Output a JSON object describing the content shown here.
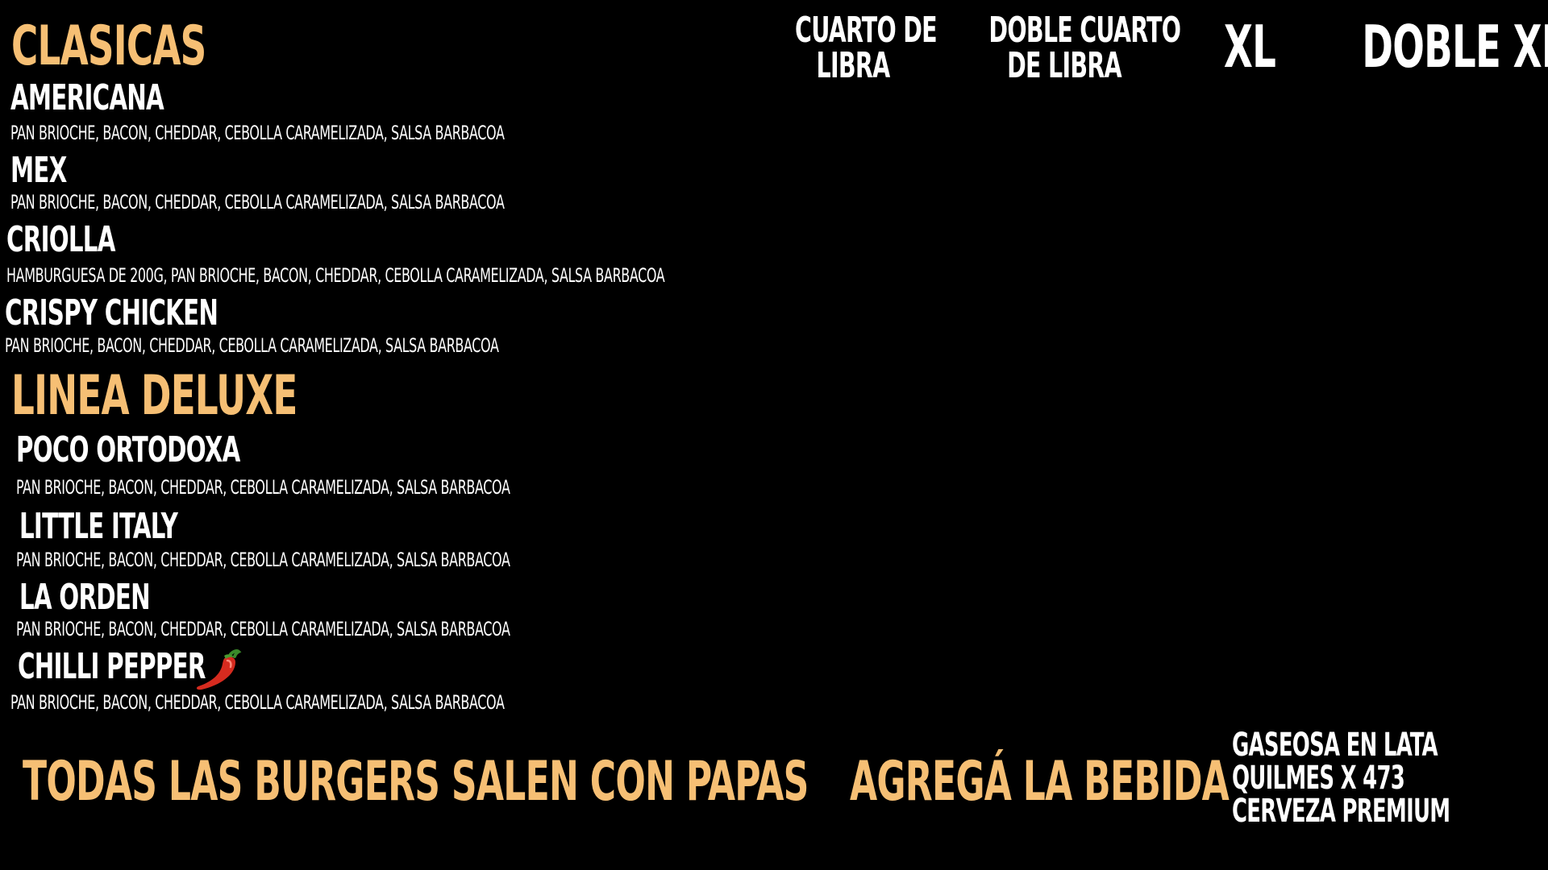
{
  "sections": {
    "clasicas": "Clasicas",
    "deluxe": "Linea Deluxe"
  },
  "sizes": {
    "cuarto_line1": "Cuarto de",
    "cuarto_line2": "Libra",
    "doble_cuarto_line1": "Doble Cuarto",
    "doble_cuarto_line2": "de Libra",
    "xl": "XL",
    "doble_xl": "Doble XL"
  },
  "clasicas_items": [
    {
      "name": "Americana",
      "desc": "Pan brioche, bacon, cheddar, cebolla caramelizada, salsa barbacoa"
    },
    {
      "name": "Mex",
      "desc": "Pan brioche, bacon, cheddar, cebolla caramelizada, salsa barbacoa"
    },
    {
      "name": "Criolla",
      "desc": "Hamburguesa de 200g, pan brioche, bacon, cheddar, cebolla caramelizada, salsa barbacoa"
    },
    {
      "name": "Crispy Chicken",
      "desc": "Pan brioche, bacon, cheddar, cebolla caramelizada, salsa barbacoa"
    }
  ],
  "deluxe_items": [
    {
      "name": "Poco Ortodoxa",
      "desc": "Pan brioche, bacon, cheddar, cebolla caramelizada, salsa barbacoa"
    },
    {
      "name": "Little Italy",
      "desc": "Pan brioche, bacon, cheddar, cebolla caramelizada, salsa barbacoa"
    },
    {
      "name": "La Orden",
      "desc": "Pan brioche, bacon, cheddar, cebolla caramelizada, salsa barbacoa"
    },
    {
      "name": "Chilli Pepper",
      "desc": "Pan brioche, bacon, cheddar, cebolla caramelizada, salsa barbacoa",
      "icon": "chili-pepper-icon"
    }
  ],
  "footer": {
    "papas": "Todas las burgers salen con papas",
    "bebida": "Agregá la bebida",
    "drinks": [
      "Gaseosa en lata",
      "Quilmes x 473",
      "Cerveza premium"
    ]
  },
  "colors": {
    "background": "#000000",
    "accent": "#f6bf74",
    "text": "#ffffff"
  }
}
